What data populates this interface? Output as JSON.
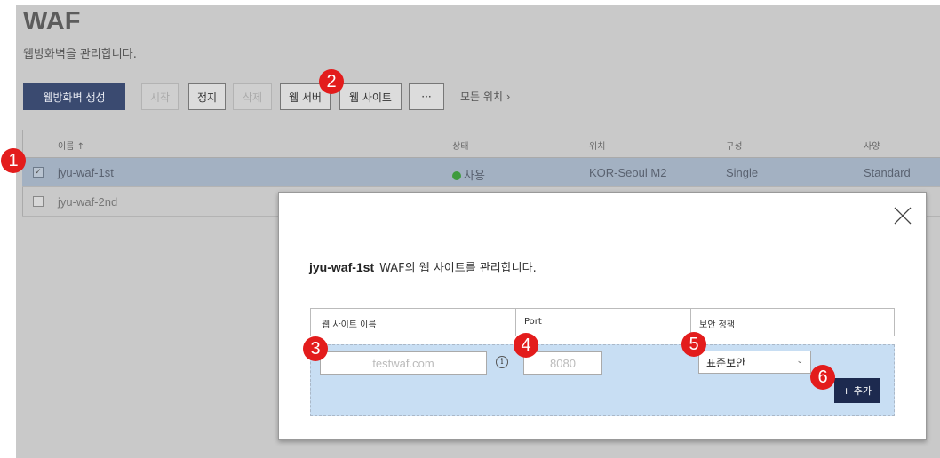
{
  "header": {
    "title": "WAF",
    "subtitle": "웹방화벽을 관리합니다."
  },
  "toolbar": {
    "create_label": "웹방화벽 생성",
    "start_label": "시작",
    "stop_label": "정지",
    "delete_label": "삭제",
    "web_server_label": "웹 서버",
    "web_site_label": "웹 사이트",
    "more_label": "···",
    "location_link": "모든 위치 ›"
  },
  "table": {
    "columns": [
      "이름 ↑",
      "상태",
      "위치",
      "구성",
      "사양"
    ],
    "rows": [
      {
        "checked": "✓",
        "name": "jyu-waf-1st",
        "status": "사용",
        "location": "KOR-Seoul M2",
        "config": "Single",
        "spec": "Standard"
      },
      {
        "checked": "",
        "name": "jyu-waf-2nd"
      }
    ]
  },
  "modal": {
    "waf_name": "jyu-waf-1st",
    "description": "WAF의 웹 사이트를 관리합니다.",
    "columns": [
      "웹 사이트 이름",
      "Port",
      "보안 정책"
    ],
    "site_name_placeholder": "testwaf.com",
    "port_placeholder": "8080",
    "policy_selected": "표준보안",
    "add_label": "+ 추가",
    "info_glyph": "i",
    "chevron_glyph": "⌄"
  },
  "badges": [
    "1",
    "2",
    "3",
    "4",
    "5",
    "6"
  ],
  "colors": {
    "badge": "#e31c1c",
    "primary_button": "#3a4a70",
    "add_button": "#1d2a4f",
    "selected_row": "#a3b1c2",
    "status_active": "#3e9b3e",
    "modal_input_area": "#c8def3"
  }
}
